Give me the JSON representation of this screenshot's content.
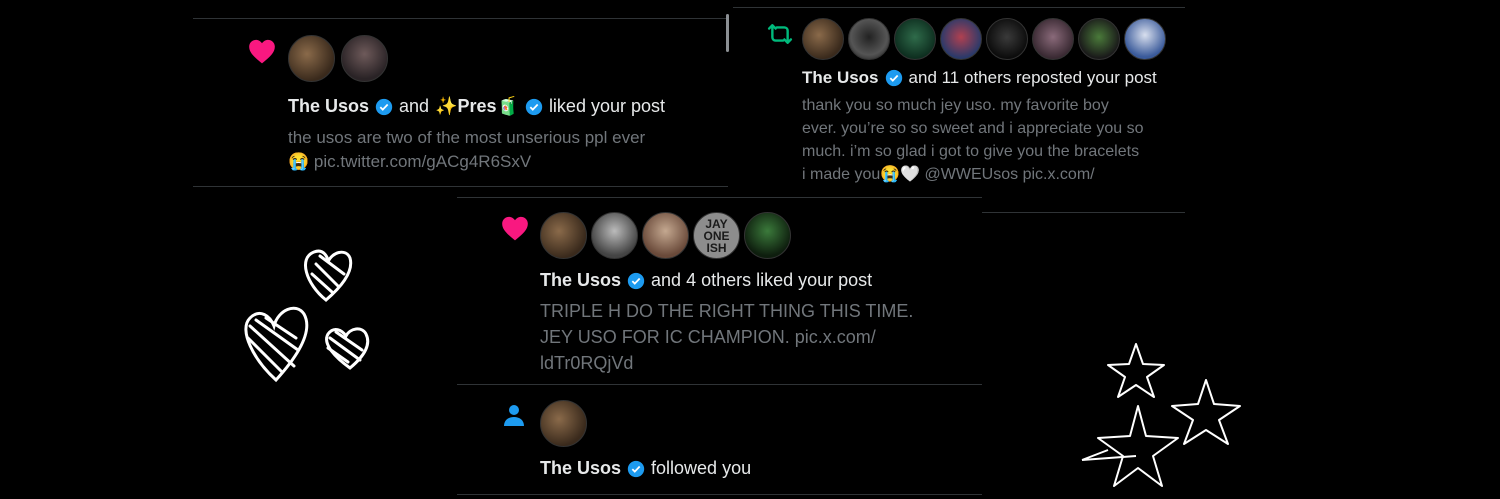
{
  "notif1": {
    "name": "The Usos",
    "connector": "and",
    "name2": "✨Pres🧃",
    "action": "liked your post",
    "body_line1": "the usos are two of the most unserious ppl ever",
    "body_line2": "😭 pic.twitter.com/gACg4R6SxV"
  },
  "notif2": {
    "name": "The Usos",
    "action": "and 11 others reposted your post",
    "body_line1": "thank you so much jey uso. my favorite boy",
    "body_line2": "ever. you’re so so sweet and i appreciate you so",
    "body_line3": "much. i’m so glad i got to give you the bracelets",
    "body_line4": "i made you😭🤍 @WWEUsos pic.x.com/"
  },
  "notif3": {
    "name": "The Usos",
    "action": "and 4 others liked your post",
    "body_line1": "TRIPLE H DO THE RIGHT THING THIS TIME.",
    "body_line2": "JEY USO FOR IC CHAMPION. pic.x.com/",
    "body_line3": "ldTr0RQjVd",
    "avatar_text": "JAY ONE ISH"
  },
  "notif4": {
    "name": "The Usos",
    "action": "followed you"
  },
  "colors": {
    "heart": "#f91880",
    "retweet": "#00ba7c",
    "follow": "#1d9bf0",
    "verified": "#1d9bf0",
    "secondary_text": "#71767b",
    "background": "#000000"
  },
  "icons": [
    "heart-icon",
    "retweet-icon",
    "person-icon",
    "verified-icon",
    "doodle-hearts",
    "doodle-stars"
  ]
}
